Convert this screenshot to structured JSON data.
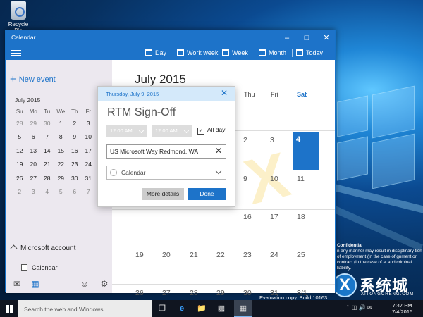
{
  "desktop": {
    "recycle_bin_label": "Recycle Bin",
    "watermark_title": "Confidential",
    "watermark_body": "n any manner may result in disciplinary tion of employment (in the case of gnment or contract (in the case of al and criminal liability.",
    "eval_text": "Evaluation copy. Build 10163.",
    "logo_main": "系统城",
    "logo_sub": "XITONGCHENG.COM"
  },
  "window": {
    "title": "Calendar",
    "toolbar": {
      "day": "Day",
      "work_week": "Work week",
      "week": "Week",
      "month": "Month",
      "today": "Today"
    }
  },
  "sidebar": {
    "new_event": "New event",
    "mini_month": "July 2015",
    "weekdays": [
      "Su",
      "Mo",
      "Tu",
      "We",
      "Th",
      "Fr",
      "Sa"
    ],
    "weeks": [
      [
        "28",
        "29",
        "30",
        "1",
        "2",
        "3",
        ""
      ],
      [
        "5",
        "6",
        "7",
        "8",
        "9",
        "10",
        ""
      ],
      [
        "12",
        "13",
        "14",
        "15",
        "16",
        "17",
        ""
      ],
      [
        "19",
        "20",
        "21",
        "22",
        "23",
        "24",
        ""
      ],
      [
        "26",
        "27",
        "28",
        "29",
        "30",
        "31",
        ""
      ],
      [
        "2",
        "3",
        "4",
        "5",
        "6",
        "7",
        ""
      ]
    ],
    "account": "Microsoft account",
    "calendar_item": "Calendar"
  },
  "main": {
    "month_title": "July 2015",
    "day_headers": {
      "thu": "Thu",
      "fri": "Fri",
      "sat": "Sat"
    },
    "dates": {
      "r1": [
        "2",
        "3",
        "4"
      ],
      "r2": [
        "9",
        "10",
        "11"
      ],
      "r3": [
        "16",
        "17",
        "18"
      ],
      "r4": [
        "19",
        "20",
        "21",
        "22",
        "23",
        "24",
        "25"
      ],
      "r5": [
        "26",
        "27",
        "28",
        "29",
        "30",
        "31",
        "8/1"
      ]
    }
  },
  "popup": {
    "date": "Thursday, July 9, 2015",
    "title": "RTM Sign-Off",
    "start_time": "12:00 AM",
    "end_time": "12:00 AM",
    "all_day": "All day",
    "location": "US Microsoft Way Redmond, WA",
    "calendar": "Calendar",
    "more_details": "More details",
    "done": "Done"
  },
  "taskbar": {
    "search_placeholder": "Search the web and Windows",
    "time": "7:47 PM",
    "date": "7/4/2015"
  }
}
